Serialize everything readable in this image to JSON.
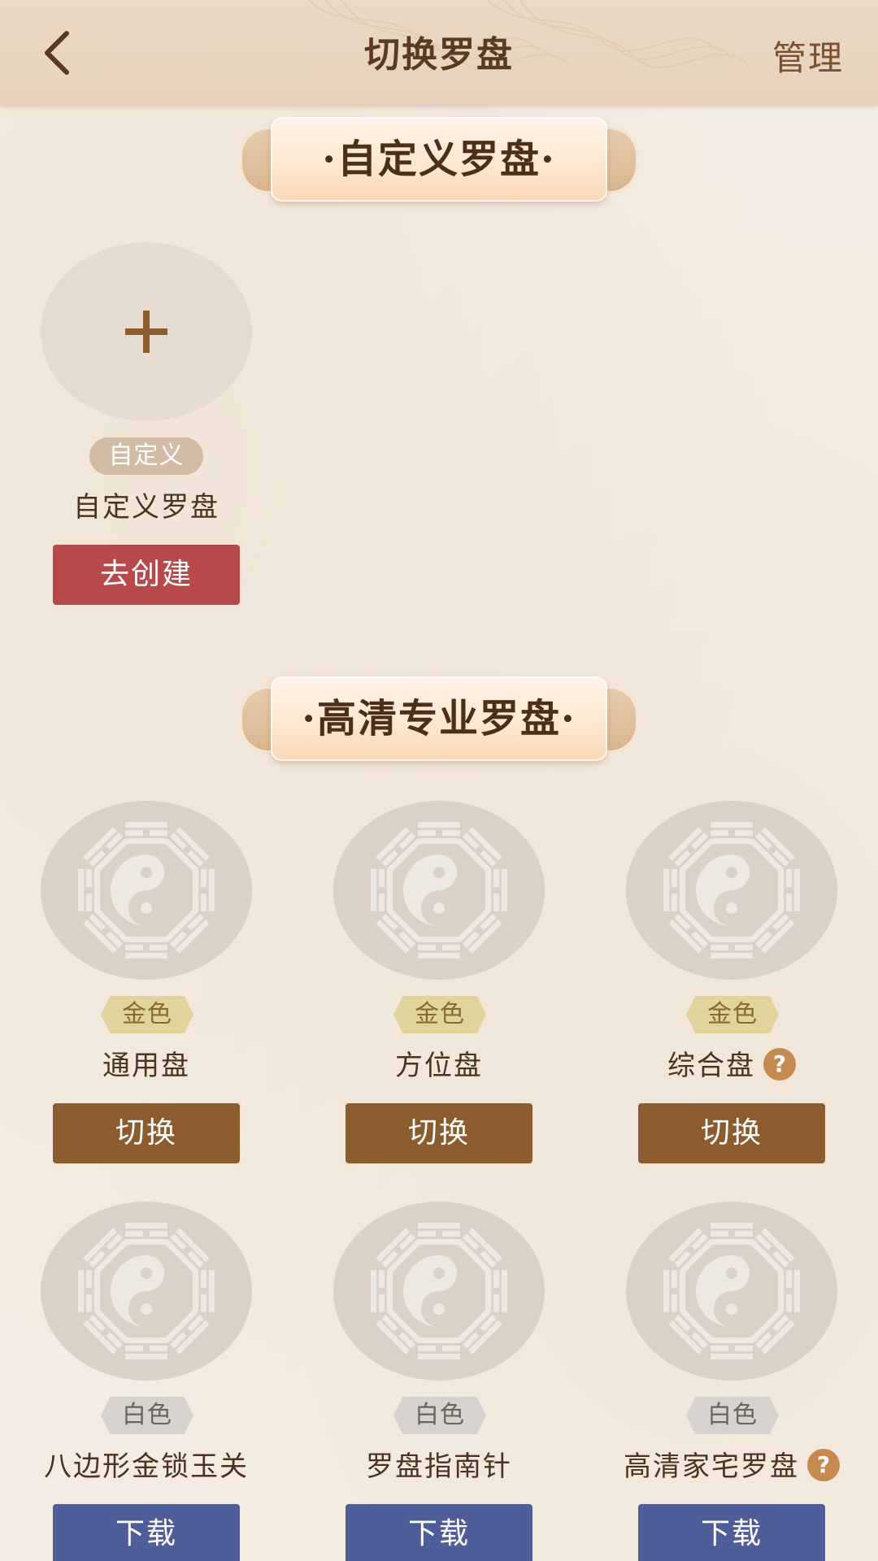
{
  "header": {
    "back_icon": "chevron-left-icon",
    "title": "切换罗盘",
    "manage_label": "管理"
  },
  "custom_section": {
    "banner_text": "·自定义罗盘·",
    "card": {
      "icon": "plus-icon",
      "tag": "自定义",
      "name": "自定义罗盘",
      "button": "去创建"
    }
  },
  "pro_section": {
    "banner_text": "·高清专业罗盘·",
    "cards": [
      {
        "tag": "金色",
        "name": "通用盘",
        "button": "切换",
        "help": false
      },
      {
        "tag": "金色",
        "name": "方位盘",
        "button": "切换",
        "help": false
      },
      {
        "tag": "金色",
        "name": "综合盘",
        "button": "切换",
        "help": true
      },
      {
        "tag": "白色",
        "name": "八边形金锁玉关",
        "button": "下载",
        "help": false
      },
      {
        "tag": "白色",
        "name": "罗盘指南针",
        "button": "下载",
        "help": false
      },
      {
        "tag": "白色",
        "name": "高清家宅罗盘",
        "button": "下载",
        "help": true
      }
    ],
    "help_glyph": "?"
  },
  "colors": {
    "background": "#f4ece2",
    "header": "#e6d2bc",
    "title": "#5a3b1f",
    "create_button": "#b8494a",
    "switch_button": "#8b5c2e",
    "download_button": "#4f5e9a",
    "gold_tag": "#e0d49c",
    "white_tag": "#d6d3cf",
    "help_icon": "#c48a4e"
  }
}
